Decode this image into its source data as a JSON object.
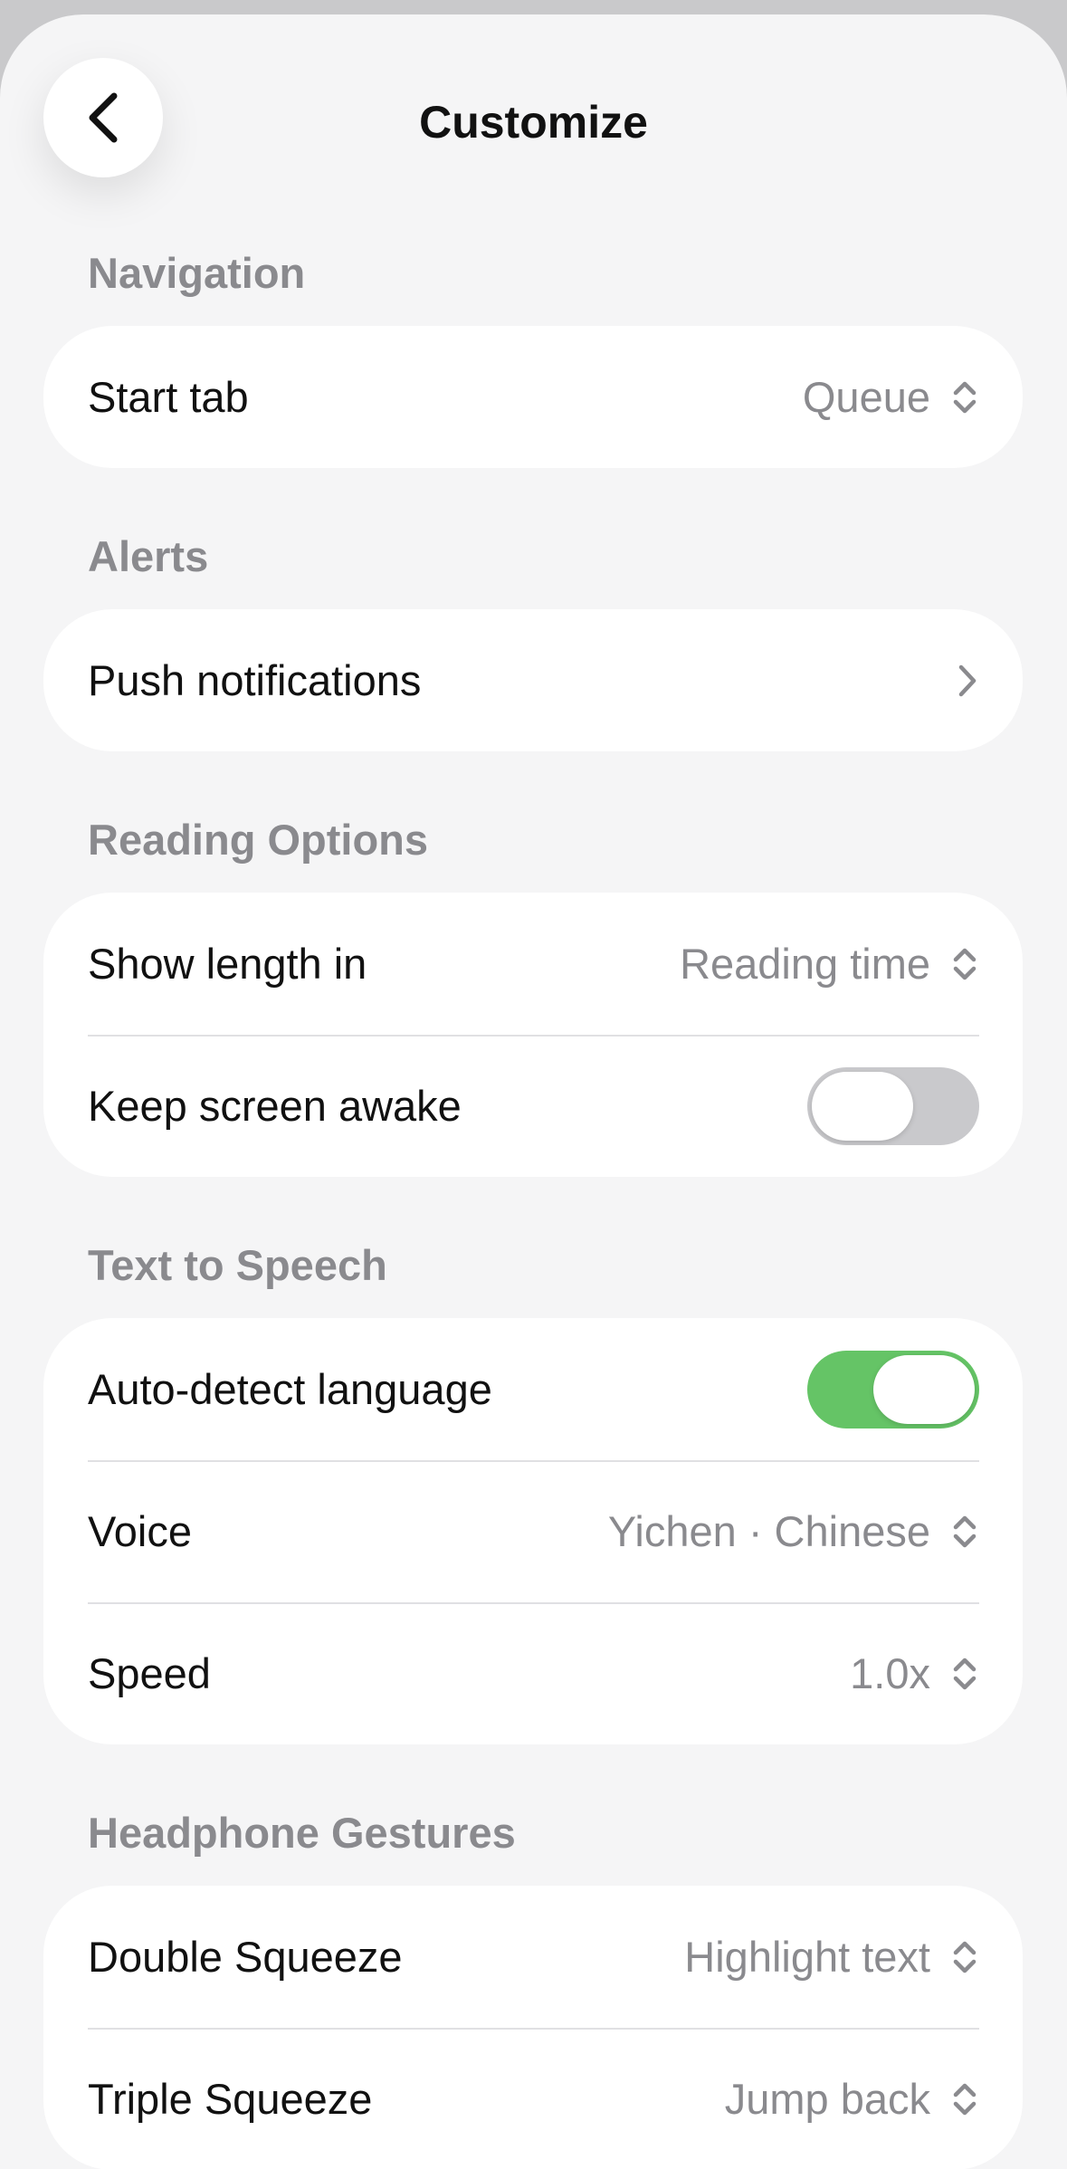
{
  "header": {
    "title": "Customize"
  },
  "sections": {
    "navigation": {
      "label": "Navigation",
      "start_tab": {
        "label": "Start tab",
        "value": "Queue"
      }
    },
    "alerts": {
      "label": "Alerts",
      "push": {
        "label": "Push notifications"
      }
    },
    "reading": {
      "label": "Reading Options",
      "show_length": {
        "label": "Show length in",
        "value": "Reading time"
      },
      "keep_awake": {
        "label": "Keep screen awake",
        "enabled": false
      }
    },
    "tts": {
      "label": "Text to Speech",
      "auto_detect": {
        "label": "Auto-detect language",
        "enabled": true
      },
      "voice": {
        "label": "Voice",
        "value": "Yichen · Chinese"
      },
      "speed": {
        "label": "Speed",
        "value": "1.0x"
      }
    },
    "headphone": {
      "label": "Headphone Gestures",
      "double": {
        "label": "Double Squeeze",
        "value": "Highlight text"
      },
      "triple": {
        "label": "Triple Squeeze",
        "value": "Jump back"
      }
    }
  },
  "colors": {
    "toggle_on": "#65c466",
    "toggle_off": "#c9c9cc",
    "secondary_text": "#8a8a8e"
  },
  "icons": {
    "back": "chevron-left-icon",
    "updown": "chevron-up-down-icon",
    "disclosure": "chevron-right-icon"
  }
}
